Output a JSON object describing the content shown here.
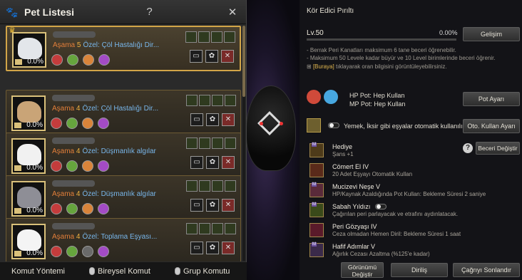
{
  "left_panel": {
    "title": "Pet Listesi",
    "help_label": "?",
    "close_label": "✕",
    "pets": [
      {
        "stage_label": "Aşama",
        "stage": "5",
        "special": "Özel: Çöl Hastalığı Dir...",
        "percent": "0.0%",
        "animal_color": "#e3e6ea",
        "selected": true
      },
      {
        "stage_label": "Aşama",
        "stage": "4",
        "special": "Özel: Çöl Hastalığı Dir...",
        "percent": "0.0%",
        "animal_color": "#c9a477"
      },
      {
        "stage_label": "Aşama",
        "stage": "4",
        "special": "Özel: Düşmanlık algılar",
        "percent": "0.0%",
        "animal_color": "#f1f1f1"
      },
      {
        "stage_label": "Aşama",
        "stage": "4",
        "special": "Özel: Düşmanlık algılar",
        "percent": "0.0%",
        "animal_color": "#8e8e96"
      },
      {
        "stage_label": "Aşama",
        "stage": "4",
        "special": "Özel: Toplama Eşyası...",
        "percent": "0.0%",
        "animal_color": "#f4f4f4"
      }
    ],
    "footer": {
      "method": "Komut Yöntemi",
      "individual": "Bireysel Komut",
      "group": "Grup Komutu"
    }
  },
  "right_panel": {
    "title": "Kör Edici Pırıltı",
    "level": "Lv.50",
    "percent": "0.00%",
    "develop_button": "Gelişim",
    "notes": [
      "- Berrak Peri Kanatları maksimum 6 tane beceri öğrenebilir.",
      "- Maksimum 50 Levele kadar büyür ve 10 Level birimlerinde beceri öğrenir."
    ],
    "link_note_pre": "[Buraya]",
    "link_note_post": " tıklayarak oran bilgisini görüntüleyebilirsiniz.",
    "hp_pot": "HP Pot: Hep Kullan",
    "mp_pot": "MP Pot: Hep Kullan",
    "pot_button": "Pot Ayarı",
    "auto_use_text": "Yemek, İksir gibi eşyalar otomatik kullanılır.",
    "auto_use_button": "Oto. Kullan Ayarı",
    "change_skill_button": "Beceri Değiştir",
    "skills": [
      {
        "name": "Hediye",
        "desc": "Şans +1",
        "mark": "M"
      },
      {
        "name": "Cömert El IV",
        "desc": "20 Adet Eşyayı Otomatik Kullan",
        "mark": ""
      },
      {
        "name": "Mucizevi Neşe V",
        "desc": "HP/Kaynak Azaldığında Pot Kullan: Bekleme Süresi 2 saniye",
        "mark": "M"
      },
      {
        "name": "Sabah Yıldızı",
        "desc": "Çağırılan peri parlayacak ve etrafını aydınlatacak.",
        "mark": "M"
      },
      {
        "name": "Peri Gözyaşı IV",
        "desc": "Ceza olmadan Hemen Diril: Bekleme Süresi 1 saat",
        "mark": ""
      },
      {
        "name": "Hafif Adımlar V",
        "desc": "Ağırlık Cezası Azaltma (%125'e kadar)",
        "mark": "M"
      }
    ],
    "bottom_buttons": {
      "appearance": "Görünümü Değiştir",
      "revive": "Diriliş",
      "end_summon": "Çağrıyı Sonlandır"
    }
  }
}
